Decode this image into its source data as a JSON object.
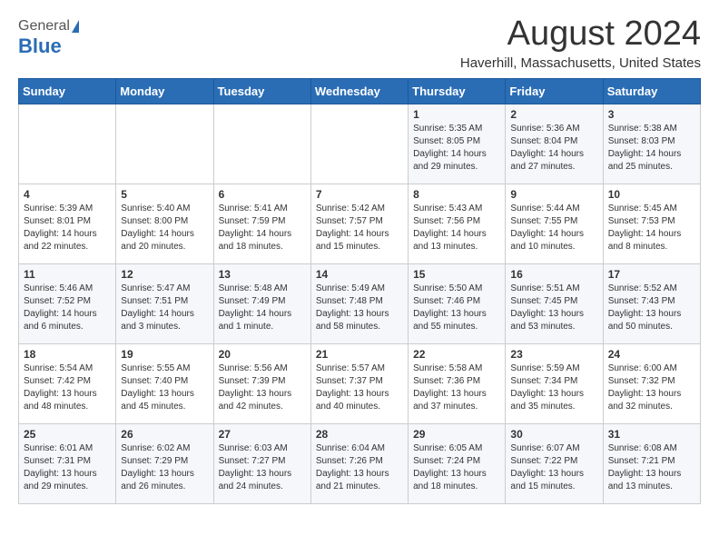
{
  "header": {
    "logo_general": "General",
    "logo_blue": "Blue",
    "month_year": "August 2024",
    "location": "Haverhill, Massachusetts, United States"
  },
  "days_of_week": [
    "Sunday",
    "Monday",
    "Tuesday",
    "Wednesday",
    "Thursday",
    "Friday",
    "Saturday"
  ],
  "weeks": [
    [
      {
        "day": "",
        "info": ""
      },
      {
        "day": "",
        "info": ""
      },
      {
        "day": "",
        "info": ""
      },
      {
        "day": "",
        "info": ""
      },
      {
        "day": "1",
        "info": "Sunrise: 5:35 AM\nSunset: 8:05 PM\nDaylight: 14 hours\nand 29 minutes."
      },
      {
        "day": "2",
        "info": "Sunrise: 5:36 AM\nSunset: 8:04 PM\nDaylight: 14 hours\nand 27 minutes."
      },
      {
        "day": "3",
        "info": "Sunrise: 5:38 AM\nSunset: 8:03 PM\nDaylight: 14 hours\nand 25 minutes."
      }
    ],
    [
      {
        "day": "4",
        "info": "Sunrise: 5:39 AM\nSunset: 8:01 PM\nDaylight: 14 hours\nand 22 minutes."
      },
      {
        "day": "5",
        "info": "Sunrise: 5:40 AM\nSunset: 8:00 PM\nDaylight: 14 hours\nand 20 minutes."
      },
      {
        "day": "6",
        "info": "Sunrise: 5:41 AM\nSunset: 7:59 PM\nDaylight: 14 hours\nand 18 minutes."
      },
      {
        "day": "7",
        "info": "Sunrise: 5:42 AM\nSunset: 7:57 PM\nDaylight: 14 hours\nand 15 minutes."
      },
      {
        "day": "8",
        "info": "Sunrise: 5:43 AM\nSunset: 7:56 PM\nDaylight: 14 hours\nand 13 minutes."
      },
      {
        "day": "9",
        "info": "Sunrise: 5:44 AM\nSunset: 7:55 PM\nDaylight: 14 hours\nand 10 minutes."
      },
      {
        "day": "10",
        "info": "Sunrise: 5:45 AM\nSunset: 7:53 PM\nDaylight: 14 hours\nand 8 minutes."
      }
    ],
    [
      {
        "day": "11",
        "info": "Sunrise: 5:46 AM\nSunset: 7:52 PM\nDaylight: 14 hours\nand 6 minutes."
      },
      {
        "day": "12",
        "info": "Sunrise: 5:47 AM\nSunset: 7:51 PM\nDaylight: 14 hours\nand 3 minutes."
      },
      {
        "day": "13",
        "info": "Sunrise: 5:48 AM\nSunset: 7:49 PM\nDaylight: 14 hours\nand 1 minute."
      },
      {
        "day": "14",
        "info": "Sunrise: 5:49 AM\nSunset: 7:48 PM\nDaylight: 13 hours\nand 58 minutes."
      },
      {
        "day": "15",
        "info": "Sunrise: 5:50 AM\nSunset: 7:46 PM\nDaylight: 13 hours\nand 55 minutes."
      },
      {
        "day": "16",
        "info": "Sunrise: 5:51 AM\nSunset: 7:45 PM\nDaylight: 13 hours\nand 53 minutes."
      },
      {
        "day": "17",
        "info": "Sunrise: 5:52 AM\nSunset: 7:43 PM\nDaylight: 13 hours\nand 50 minutes."
      }
    ],
    [
      {
        "day": "18",
        "info": "Sunrise: 5:54 AM\nSunset: 7:42 PM\nDaylight: 13 hours\nand 48 minutes."
      },
      {
        "day": "19",
        "info": "Sunrise: 5:55 AM\nSunset: 7:40 PM\nDaylight: 13 hours\nand 45 minutes."
      },
      {
        "day": "20",
        "info": "Sunrise: 5:56 AM\nSunset: 7:39 PM\nDaylight: 13 hours\nand 42 minutes."
      },
      {
        "day": "21",
        "info": "Sunrise: 5:57 AM\nSunset: 7:37 PM\nDaylight: 13 hours\nand 40 minutes."
      },
      {
        "day": "22",
        "info": "Sunrise: 5:58 AM\nSunset: 7:36 PM\nDaylight: 13 hours\nand 37 minutes."
      },
      {
        "day": "23",
        "info": "Sunrise: 5:59 AM\nSunset: 7:34 PM\nDaylight: 13 hours\nand 35 minutes."
      },
      {
        "day": "24",
        "info": "Sunrise: 6:00 AM\nSunset: 7:32 PM\nDaylight: 13 hours\nand 32 minutes."
      }
    ],
    [
      {
        "day": "25",
        "info": "Sunrise: 6:01 AM\nSunset: 7:31 PM\nDaylight: 13 hours\nand 29 minutes."
      },
      {
        "day": "26",
        "info": "Sunrise: 6:02 AM\nSunset: 7:29 PM\nDaylight: 13 hours\nand 26 minutes."
      },
      {
        "day": "27",
        "info": "Sunrise: 6:03 AM\nSunset: 7:27 PM\nDaylight: 13 hours\nand 24 minutes."
      },
      {
        "day": "28",
        "info": "Sunrise: 6:04 AM\nSunset: 7:26 PM\nDaylight: 13 hours\nand 21 minutes."
      },
      {
        "day": "29",
        "info": "Sunrise: 6:05 AM\nSunset: 7:24 PM\nDaylight: 13 hours\nand 18 minutes."
      },
      {
        "day": "30",
        "info": "Sunrise: 6:07 AM\nSunset: 7:22 PM\nDaylight: 13 hours\nand 15 minutes."
      },
      {
        "day": "31",
        "info": "Sunrise: 6:08 AM\nSunset: 7:21 PM\nDaylight: 13 hours\nand 13 minutes."
      }
    ]
  ]
}
